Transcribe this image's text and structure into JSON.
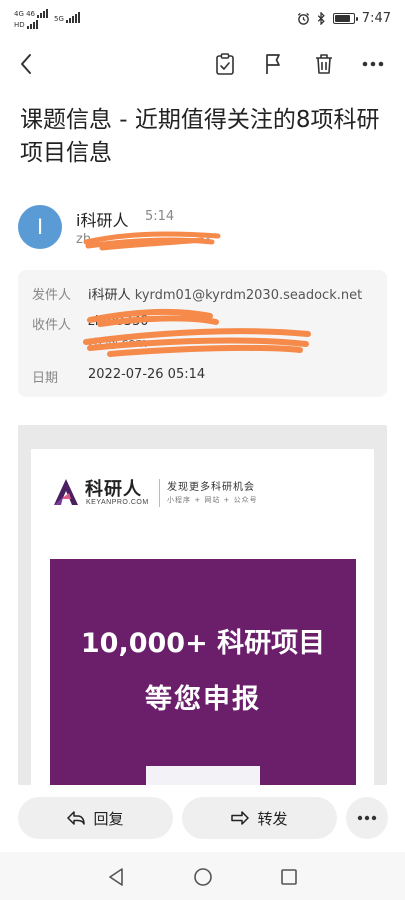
{
  "status_bar": {
    "sim1_label": "4G 46",
    "sim2_label": "HD",
    "wifi_label": "5G",
    "time": "7:47",
    "battery_level": 0.85,
    "icons": [
      "alarm-icon",
      "bluetooth-icon",
      "battery-icon"
    ]
  },
  "toolbar": {
    "icons": [
      "back-arrow-icon",
      "clipboard-check-icon",
      "flag-icon",
      "trash-icon",
      "more-horizontal-icon"
    ]
  },
  "email": {
    "subject": "课题信息 - 近期值得关注的8项科研项目信息",
    "sender": {
      "avatar_letter": "I",
      "avatar_color": "#5b9bd5",
      "name": "i科研人",
      "time": "5:14",
      "address_visible": "zh"
    },
    "details": {
      "from_label": "发件人",
      "from_name": "i科研人",
      "from_email": "kyrdm01@kyrdm2030.seadock.net",
      "to_label": "收件人",
      "to_value_line1": "zh                              90330",
      "to_value_line2": "zh                                    @.com",
      "date_label": "日期",
      "date_value": "2022-07-26 05:14"
    }
  },
  "body": {
    "brand_name": "科研人",
    "brand_sub": "KEYANPRO.COM",
    "tagline": "发现更多科研机会",
    "tagline_sub": "小程序 + 网站 + 公众号",
    "promo_line1": "10,000+ 科研项目",
    "promo_line2": "等您申报",
    "promo_color": "#6b1f6b"
  },
  "actions": {
    "reply_label": "回复",
    "forward_label": "转发"
  },
  "nav": {
    "icons": [
      "nav-back-icon",
      "nav-home-icon",
      "nav-recents-icon"
    ]
  },
  "redaction_color": "#f58a4b"
}
